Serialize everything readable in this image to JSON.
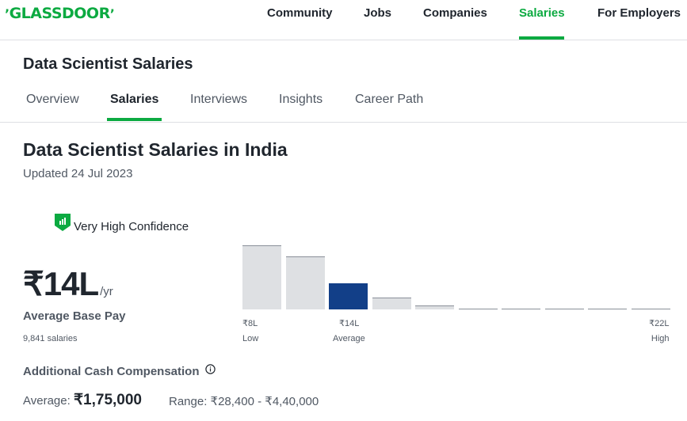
{
  "topnav": {
    "logo": "GLASSDOOR",
    "items": [
      "Community",
      "Jobs",
      "Companies",
      "Salaries",
      "For Employers"
    ],
    "active": "Salaries"
  },
  "subheader": {
    "title": "Data Scientist Salaries",
    "tabs": [
      "Overview",
      "Salaries",
      "Interviews",
      "Insights",
      "Career Path"
    ],
    "active_tab": "Salaries"
  },
  "main": {
    "title": "Data Scientist Salaries in India",
    "updated": "Updated 24 Jul 2023",
    "confidence": "Very High Confidence",
    "base_pay_value": "₹14L",
    "base_pay_unit": "/yr",
    "base_pay_label": "Average Base Pay",
    "salary_count": "9,841 salaries",
    "additional_title": "Additional Cash Compensation",
    "additional_avg_label": "Average:",
    "additional_avg_value": "₹1,75,000",
    "additional_range": "Range: ₹28,400 - ₹4,40,000"
  },
  "chart_data": {
    "type": "bar",
    "bins": 10,
    "values": [
      81,
      67,
      33,
      15,
      5,
      1.5,
      1,
      1,
      1,
      1
    ],
    "highlight_index": 2,
    "x_tick_labels": [
      {
        "index": 0,
        "value": "₹8L",
        "caption": "Low"
      },
      {
        "index": 2,
        "value": "₹14L",
        "caption": "Average"
      },
      {
        "index": 9,
        "value": "₹22L",
        "caption": "High"
      }
    ]
  },
  "colors": {
    "brand": "#0caa41",
    "highlight_bar": "#123f88",
    "bar": "#dee0e3",
    "text": "#20262e"
  }
}
